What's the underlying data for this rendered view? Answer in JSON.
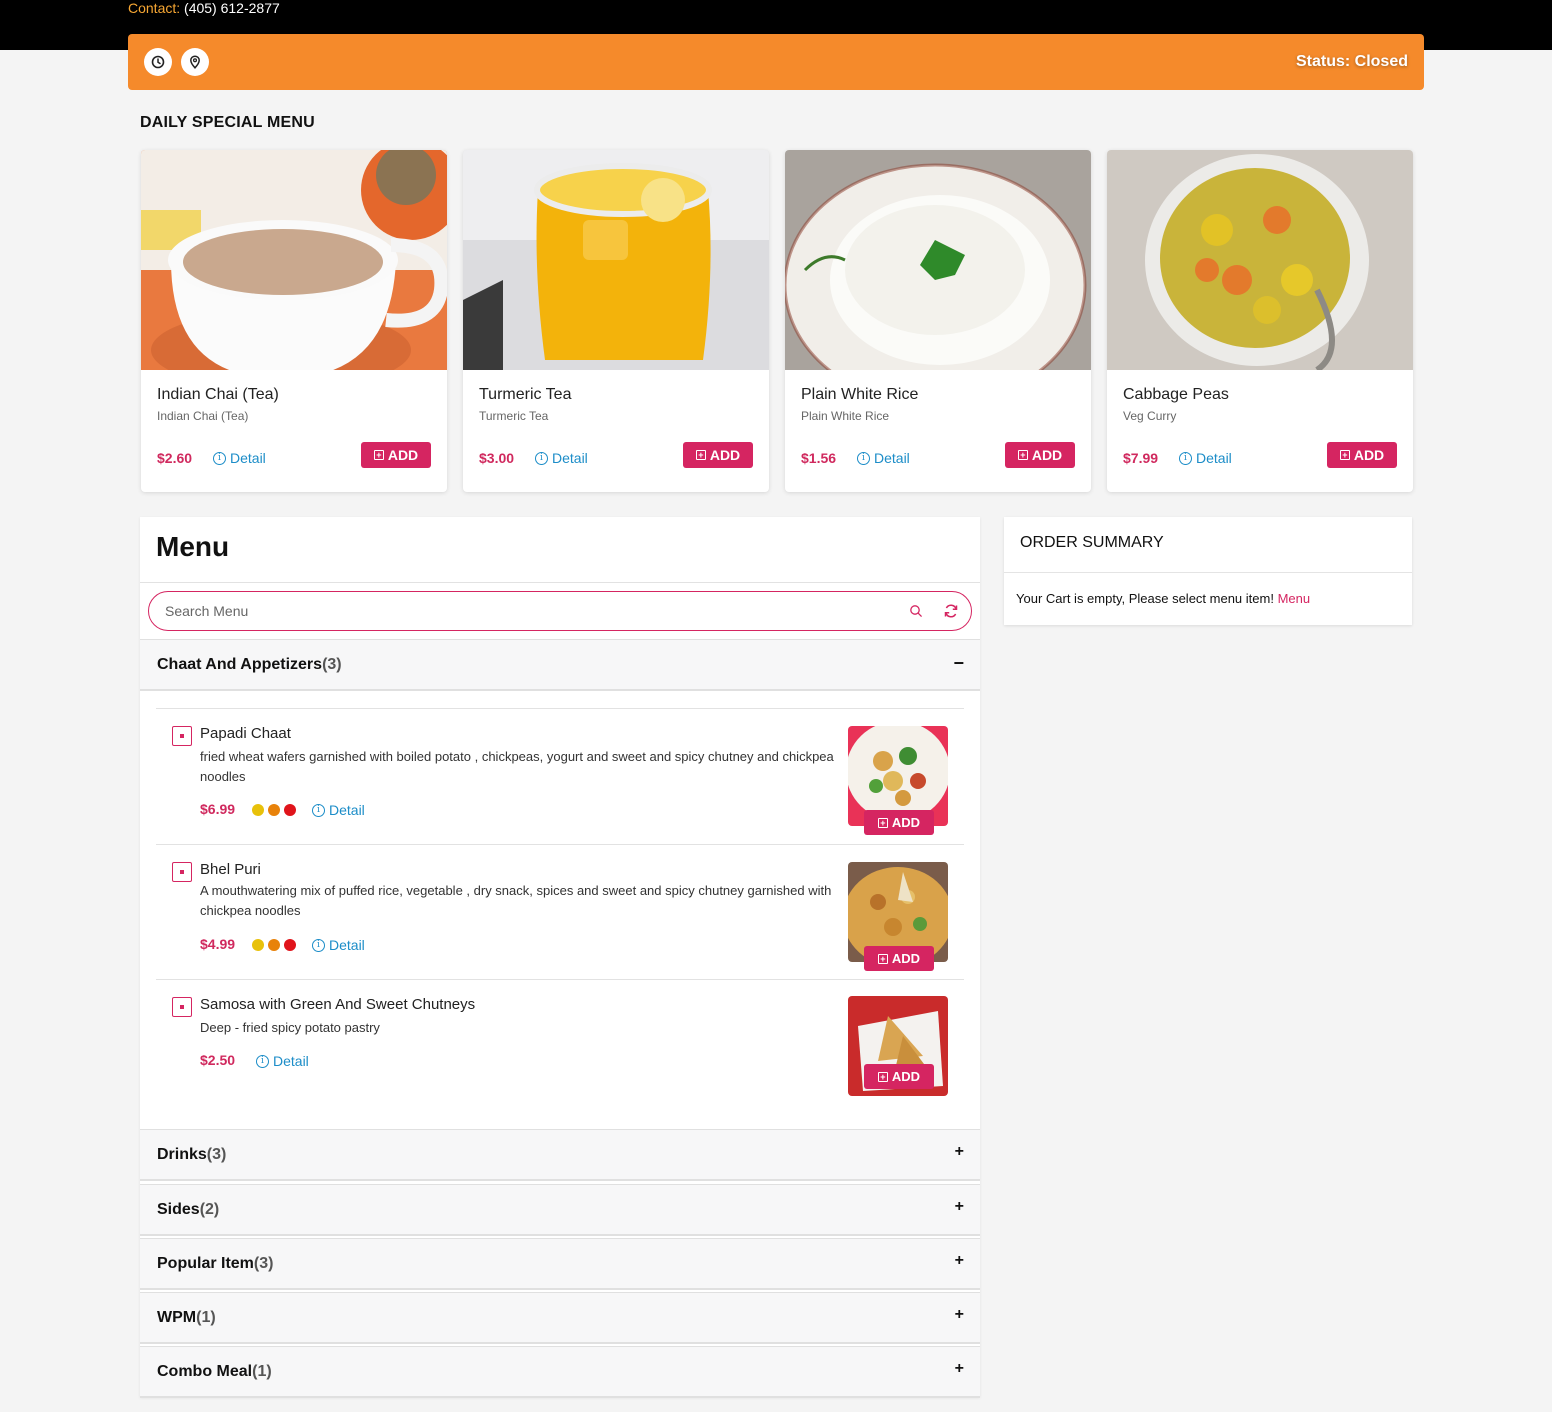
{
  "header": {
    "contact_label": "Contact:",
    "contact_phone": "(405) 612-2877",
    "status": "Status: Closed",
    "icons": [
      "clock-icon",
      "location-pin-icon"
    ],
    "colors": {
      "top_bar": "#000000",
      "status_bar": "#f58a2b",
      "accent": "#d52561",
      "link": "#1c8dc8"
    }
  },
  "daily_special": {
    "title": "DAILY SPECIAL MENU",
    "items": [
      {
        "name": "Indian Chai (Tea)",
        "sub": "Indian Chai (Tea)",
        "price": "$2.60",
        "detail": "Detail",
        "add": "ADD"
      },
      {
        "name": "Turmeric Tea",
        "sub": "Turmeric Tea",
        "price": "$3.00",
        "detail": "Detail",
        "add": "ADD"
      },
      {
        "name": "Plain White Rice",
        "sub": "Plain White Rice",
        "price": "$1.56",
        "detail": "Detail",
        "add": "ADD"
      },
      {
        "name": "Cabbage Peas",
        "sub": "Veg Curry",
        "price": "$7.99",
        "detail": "Detail",
        "add": "ADD"
      }
    ]
  },
  "menu": {
    "title": "Menu",
    "search_placeholder": "Search Menu",
    "categories": [
      {
        "name": "Chaat And Appetizers",
        "count": "(3)",
        "toggle": "−",
        "expanded": true
      },
      {
        "name": "Drinks",
        "count": "(3)",
        "toggle": "+"
      },
      {
        "name": "Sides",
        "count": "(2)",
        "toggle": "+"
      },
      {
        "name": "Popular Item",
        "count": "(3)",
        "toggle": "+"
      },
      {
        "name": "WPM",
        "count": "(1)",
        "toggle": "+"
      },
      {
        "name": "Combo Meal",
        "count": "(1)",
        "toggle": "+"
      }
    ],
    "items": [
      {
        "name": "Papadi Chaat",
        "desc": "fried wheat wafers garnished with boiled potato , chickpeas, yogurt and sweet and spicy chutney and chickpea noodles",
        "price": "$6.99",
        "spice_level": 3,
        "detail": "Detail",
        "add": "ADD"
      },
      {
        "name": "Bhel Puri",
        "desc": "A mouthwatering mix of puffed rice, vegetable , dry snack, spices and sweet and spicy chutney garnished with chickpea noodles",
        "price": "$4.99",
        "spice_level": 3,
        "detail": "Detail",
        "add": "ADD"
      },
      {
        "name": "Samosa with Green And Sweet Chutneys",
        "desc": "Deep - fried spicy potato pastry",
        "price": "$2.50",
        "spice_level": 0,
        "detail": "Detail",
        "add": "ADD"
      }
    ],
    "spice_colors": [
      "#e8c10a",
      "#e8820a",
      "#e0141b"
    ]
  },
  "order_summary": {
    "title": "ORDER SUMMARY",
    "empty_text": "Your Cart is empty, Please select menu item!",
    "menu_link": "Menu"
  }
}
